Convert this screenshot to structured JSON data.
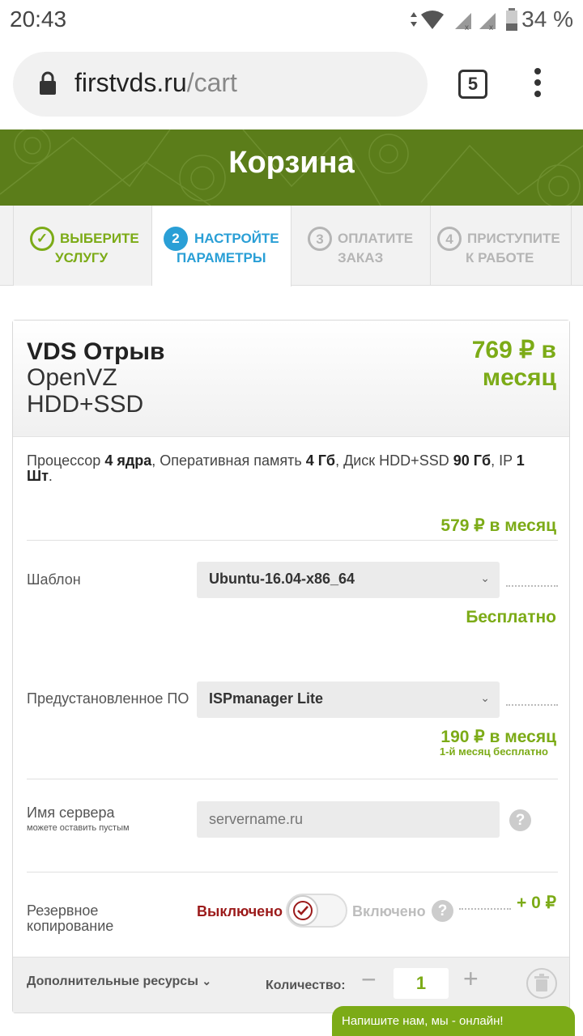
{
  "status_bar": {
    "time": "20:43",
    "battery": "34 %"
  },
  "browser": {
    "domain": "firstvds.ru",
    "path": "/cart",
    "tab_count": "5"
  },
  "banner": {
    "title": "Корзина"
  },
  "steps": [
    {
      "num": "✓",
      "line1": "ВЫБЕРИТЕ",
      "line2": "УСЛУГУ"
    },
    {
      "num": "2",
      "line1": "НАСТРОЙТЕ",
      "line2": "ПАРАМЕТРЫ"
    },
    {
      "num": "3",
      "line1": "ОПЛАТИТЕ",
      "line2": "ЗАКАЗ"
    },
    {
      "num": "4",
      "line1": "ПРИСТУПИТЕ",
      "line2": "К РАБОТЕ"
    }
  ],
  "plan": {
    "name": "VDS Отрыв",
    "type_line1": "OpenVZ",
    "type_line2": "HDD+SSD",
    "price_line1": "769 ₽ в",
    "price_line2": "месяц"
  },
  "specs": {
    "cpu_label": "Процессор ",
    "cpu_value": "4 ядра",
    "ram_label": ", Оперативная память ",
    "ram_value": "4 Гб",
    "disk_label": ", Диск HDD+SSD ",
    "disk_value": "90 Гб",
    "ip_label": ", IP ",
    "ip_value": "1",
    "ip_unit": "Шт",
    "end": "."
  },
  "base_price": "579 ₽ в месяц",
  "template": {
    "label": "Шаблон",
    "value": "Ubuntu-16.04-x86_64",
    "price": "Бесплатно"
  },
  "software": {
    "label": "Предустановленное ПО",
    "value": "ISPmanager Lite",
    "price": "190 ₽ в месяц",
    "note": "1-й месяц бесплатно"
  },
  "server_name": {
    "label": "Имя сервера",
    "hint": "можете оставить пустым",
    "placeholder": "servername.ru"
  },
  "backup": {
    "label_line1": "Резервное",
    "label_line2": "копирование",
    "off": "Выключено",
    "on": "Включено",
    "price": "+ 0 ₽"
  },
  "bottom": {
    "extra": "Дополнительные ресурсы",
    "qty_label": "Количество:",
    "qty": "1"
  },
  "chat": {
    "label": "Напишите нам, мы - онлайн!"
  }
}
